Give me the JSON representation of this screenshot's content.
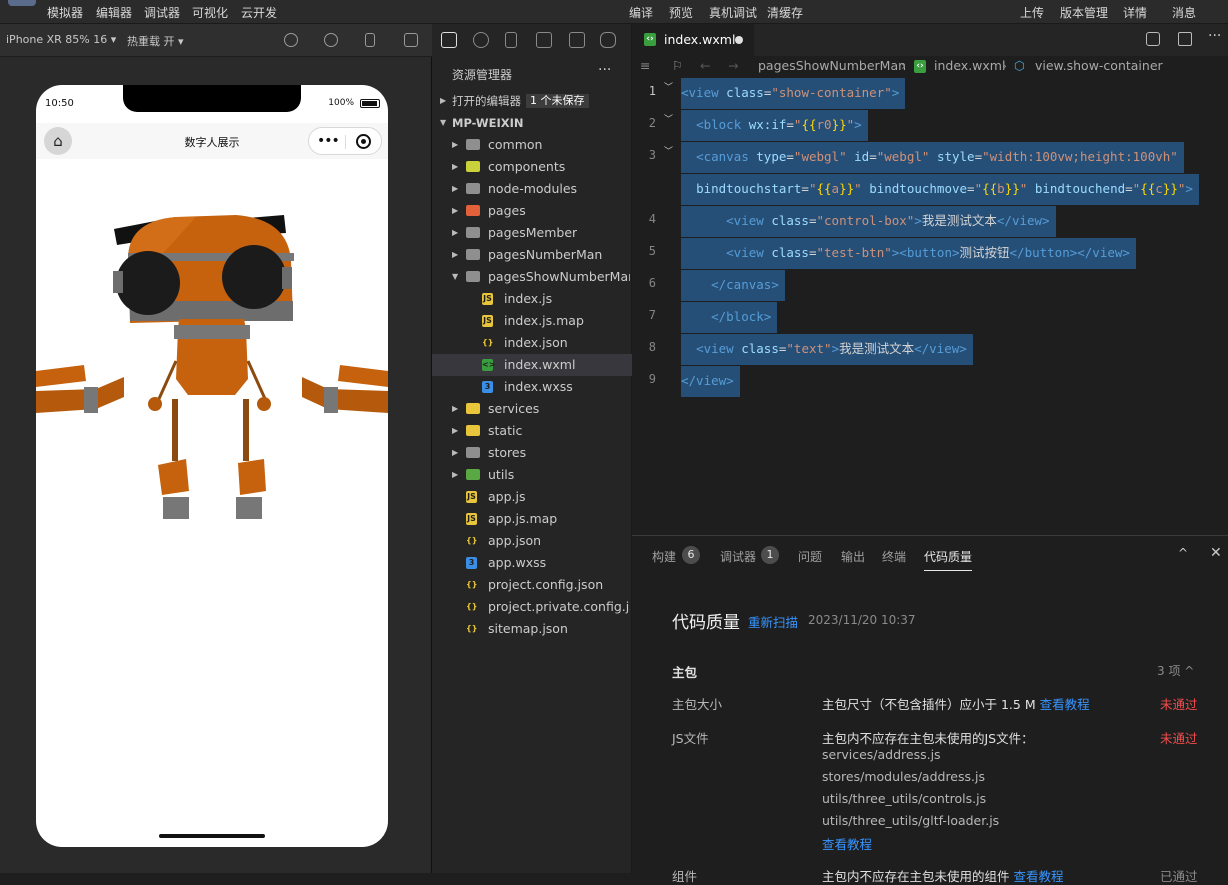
{
  "menubar": {
    "left": [
      "模拟器",
      "编辑器",
      "调试器",
      "可视化",
      "云开发"
    ],
    "center": [
      "编译",
      "预览",
      "真机调试",
      "清缓存"
    ],
    "right": [
      "上传",
      "版本管理",
      "详情",
      "消息"
    ]
  },
  "simulator": {
    "device": "iPhone XR 85% 16 ▾",
    "hot_reload": "热重载 开 ▾",
    "status_time": "10:50",
    "battery": "100%",
    "nav_title": "数字人展示",
    "capsule_dots": "•••"
  },
  "explorer": {
    "title": "资源管理器",
    "more": "···",
    "open_editors": "打开的编辑器",
    "unsaved_badge": "1 个未保存",
    "project": "MP-WEIXIN",
    "items": [
      {
        "label": "common",
        "kind": "folder",
        "color": "#8f8f8f"
      },
      {
        "label": "components",
        "kind": "folder",
        "color": "#c9d23a"
      },
      {
        "label": "node-modules",
        "kind": "folder",
        "color": "#8f8f8f"
      },
      {
        "label": "pages",
        "kind": "folder",
        "color": "#e2603a"
      },
      {
        "label": "pagesMember",
        "kind": "folder",
        "color": "#8f8f8f"
      },
      {
        "label": "pagesNumberMan",
        "kind": "folder",
        "color": "#8f8f8f"
      },
      {
        "label": "pagesShowNumberMan",
        "kind": "folder-open",
        "color": "#8f8f8f"
      },
      {
        "label": "index.js",
        "kind": "file",
        "glyph": "JS",
        "color": "#e8c53a"
      },
      {
        "label": "index.js.map",
        "kind": "file",
        "glyph": "JS",
        "color": "#e8c53a"
      },
      {
        "label": "index.json",
        "kind": "file",
        "glyph": "{}",
        "color": "#e8c53a"
      },
      {
        "label": "index.wxml",
        "kind": "file",
        "glyph": "<>",
        "color": "#3a9e3f"
      },
      {
        "label": "index.wxss",
        "kind": "file",
        "glyph": "3",
        "color": "#3a8ee6"
      },
      {
        "label": "services",
        "kind": "folder",
        "color": "#e8c53a"
      },
      {
        "label": "static",
        "kind": "folder",
        "color": "#e8c53a"
      },
      {
        "label": "stores",
        "kind": "folder",
        "color": "#8f8f8f"
      },
      {
        "label": "utils",
        "kind": "folder",
        "color": "#5aa844"
      },
      {
        "label": "app.js",
        "kind": "file",
        "glyph": "JS",
        "color": "#e8c53a"
      },
      {
        "label": "app.js.map",
        "kind": "file",
        "glyph": "JS",
        "color": "#e8c53a"
      },
      {
        "label": "app.json",
        "kind": "file",
        "glyph": "{}",
        "color": "#e8c53a"
      },
      {
        "label": "app.wxss",
        "kind": "file",
        "glyph": "3",
        "color": "#3a8ee6"
      },
      {
        "label": "project.config.json",
        "kind": "file",
        "glyph": "{}",
        "color": "#e8c53a"
      },
      {
        "label": "project.private.config.js...",
        "kind": "file",
        "glyph": "{}",
        "color": "#e8c53a"
      },
      {
        "label": "sitemap.json",
        "kind": "file",
        "glyph": "{}",
        "color": "#e8c53a"
      }
    ]
  },
  "editor": {
    "tab_label": "index.wxml",
    "breadcrumb": [
      "pagesShowNumberMan",
      "index.wxml",
      "view.show-container"
    ],
    "line_numbers": [
      "1",
      "2",
      "3",
      "4",
      "5",
      "6",
      "7",
      "8",
      "9"
    ]
  },
  "panel": {
    "tabs": [
      {
        "label": "构建",
        "count": "6"
      },
      {
        "label": "调试器",
        "count": "1"
      },
      {
        "label": "问题",
        "count": ""
      },
      {
        "label": "输出",
        "count": ""
      },
      {
        "label": "终端",
        "count": ""
      },
      {
        "label": "代码质量",
        "count": ""
      }
    ],
    "cq_title": "代码质量",
    "cq_rescan": "重新扫描",
    "cq_time": "2023/11/20 10:37",
    "section": "主包",
    "section_count": "3 项 ^",
    "row1_label": "主包大小",
    "row1_text": "主包尺寸（不包含插件）应小于 1.5 M",
    "row1_link": "查看教程",
    "row1_status": "未通过",
    "row2_label": "JS文件",
    "row2_text": "主包内不应存在主包未使用的JS文件：",
    "row2_files": [
      "services/address.js",
      "stores/modules/address.js",
      "utils/three_utils/controls.js",
      "utils/three_utils/gltf-loader.js"
    ],
    "row2_link": "查看教程",
    "row2_status": "未通过",
    "row3_label": "组件",
    "row3_text": "主包内不应存在主包未使用的组件",
    "row3_link": "查看教程",
    "row3_status": "已通过"
  }
}
